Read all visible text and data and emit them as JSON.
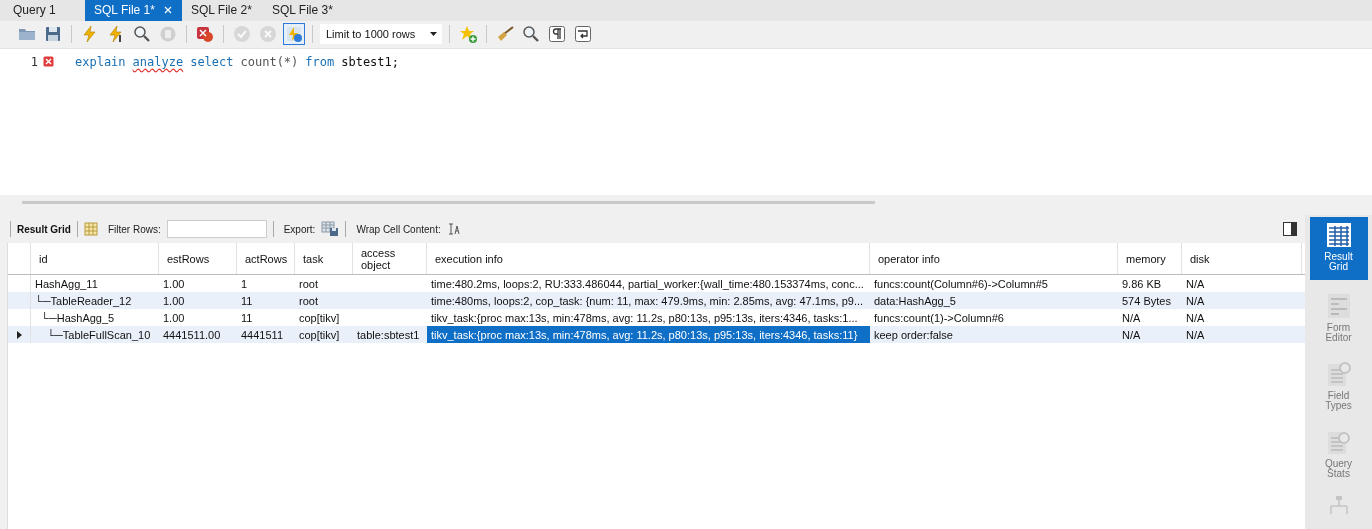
{
  "tabs": [
    {
      "label": "Query 1",
      "selected": false,
      "closable": false
    },
    {
      "label": "SQL File 1*",
      "selected": true,
      "closable": true
    },
    {
      "label": "SQL File 2*",
      "selected": false,
      "closable": false
    },
    {
      "label": "SQL File 3*",
      "selected": false,
      "closable": false
    }
  ],
  "toolbar": [
    {
      "kind": "folder",
      "disabled": false,
      "on": false
    },
    {
      "kind": "save",
      "disabled": false,
      "on": false
    },
    {
      "kind": "sep"
    },
    {
      "kind": "bolt",
      "disabled": false,
      "on": false
    },
    {
      "kind": "bolt-cursor",
      "disabled": false,
      "on": false
    },
    {
      "kind": "magnifier",
      "disabled": false,
      "on": false
    },
    {
      "kind": "stop",
      "disabled": true,
      "on": false
    },
    {
      "kind": "sep"
    },
    {
      "kind": "stop-on-error",
      "disabled": false,
      "on": false
    },
    {
      "kind": "sep"
    },
    {
      "kind": "commit",
      "disabled": true,
      "on": false
    },
    {
      "kind": "rollback",
      "disabled": true,
      "on": false
    },
    {
      "kind": "autocommit",
      "disabled": false,
      "on": true
    },
    {
      "kind": "sep"
    },
    {
      "kind": "limit",
      "value": "Limit to 1000 rows"
    },
    {
      "kind": "sep"
    },
    {
      "kind": "star",
      "disabled": false,
      "on": false
    },
    {
      "kind": "sep"
    },
    {
      "kind": "broom",
      "disabled": false,
      "on": false
    },
    {
      "kind": "find",
      "disabled": false,
      "on": false
    },
    {
      "kind": "pilcrow",
      "disabled": false,
      "on": false
    },
    {
      "kind": "wrap",
      "disabled": false,
      "on": false
    }
  ],
  "editor": {
    "lines": [
      {
        "number": "1",
        "error": true,
        "tokens": [
          {
            "text": "explain",
            "kind": "keyword",
            "squiggle": false
          },
          {
            "text": "analyze",
            "kind": "keyword",
            "squiggle": true
          },
          {
            "text": "select",
            "kind": "keyword",
            "squiggle": false
          },
          {
            "text": "count(*)",
            "kind": "function",
            "squiggle": false
          },
          {
            "text": "from",
            "kind": "keyword",
            "squiggle": false
          },
          {
            "text": "sbtest1;",
            "kind": "plain",
            "squiggle": false
          }
        ]
      }
    ]
  },
  "result_toolbar": {
    "title": "Result Grid",
    "filter_label": "Filter Rows:",
    "export_label": "Export:",
    "wrap_label": "Wrap Cell Content:"
  },
  "grid": {
    "columns": [
      "id",
      "estRows",
      "actRows",
      "task",
      "access object",
      "execution info",
      "operator info",
      "memory",
      "disk"
    ],
    "rows": [
      {
        "selected": false,
        "cells": [
          {
            "text": "HashAgg_11",
            "selected": false
          },
          {
            "text": "1.00",
            "selected": false
          },
          {
            "text": "1",
            "selected": false
          },
          {
            "text": "root",
            "selected": false
          },
          {
            "selected": false
          },
          {
            "text": "time:480.2ms, loops:2, RU:333.486044, partial_worker:{wall_time:480.153374ms, conc...",
            "selected": false
          },
          {
            "text": "funcs:count(Column#6)->Column#5",
            "selected": false
          },
          {
            "text": "9.86 KB",
            "selected": false
          },
          {
            "text": "N/A",
            "selected": false
          }
        ]
      },
      {
        "selected": false,
        "cells": [
          {
            "text": "└─TableReader_12",
            "selected": false
          },
          {
            "text": "1.00",
            "selected": false
          },
          {
            "text": "11",
            "selected": false
          },
          {
            "text": "root",
            "selected": false
          },
          {
            "selected": false
          },
          {
            "text": "time:480ms, loops:2, cop_task: {num: 11, max: 479.9ms, min: 2.85ms, avg: 47.1ms, p9...",
            "selected": false
          },
          {
            "text": "data:HashAgg_5",
            "selected": false
          },
          {
            "text": "574 Bytes",
            "selected": false
          },
          {
            "text": "N/A",
            "selected": false
          }
        ]
      },
      {
        "selected": false,
        "cells": [
          {
            "text": "  └─HashAgg_5",
            "selected": false
          },
          {
            "text": "1.00",
            "selected": false
          },
          {
            "text": "11",
            "selected": false
          },
          {
            "text": "cop[tikv]",
            "selected": false
          },
          {
            "selected": false
          },
          {
            "text": "tikv_task:{proc max:13s, min:478ms, avg: 11.2s, p80:13s, p95:13s, iters:4346, tasks:1...",
            "selected": false
          },
          {
            "text": "funcs:count(1)->Column#6",
            "selected": false
          },
          {
            "text": "N/A",
            "selected": false
          },
          {
            "text": "N/A",
            "selected": false
          }
        ]
      },
      {
        "selected": true,
        "cells": [
          {
            "text": "    └─TableFullScan_10",
            "selected": false
          },
          {
            "text": "4441511.00",
            "selected": false
          },
          {
            "text": "4441511",
            "selected": false
          },
          {
            "text": "cop[tikv]",
            "selected": false
          },
          {
            "text": "table:sbtest1",
            "selected": false
          },
          {
            "text": "tikv_task:{proc max:13s, min:478ms, avg: 11.2s, p80:13s, p95:13s, iters:4346, tasks:11}",
            "selected": true
          },
          {
            "text": "keep order:false",
            "selected": false
          },
          {
            "text": "N/A",
            "selected": false
          },
          {
            "text": "N/A",
            "selected": false
          }
        ]
      }
    ]
  },
  "side_panel": [
    {
      "label": "Result Grid",
      "kind": "grid",
      "selected": true
    },
    {
      "label": "Form Editor",
      "kind": "form",
      "selected": false
    },
    {
      "label": "Field Types",
      "kind": "types",
      "selected": false
    },
    {
      "label": "Query Stats",
      "kind": "stats",
      "selected": false
    },
    {
      "kind": "plan",
      "selected": false
    }
  ]
}
